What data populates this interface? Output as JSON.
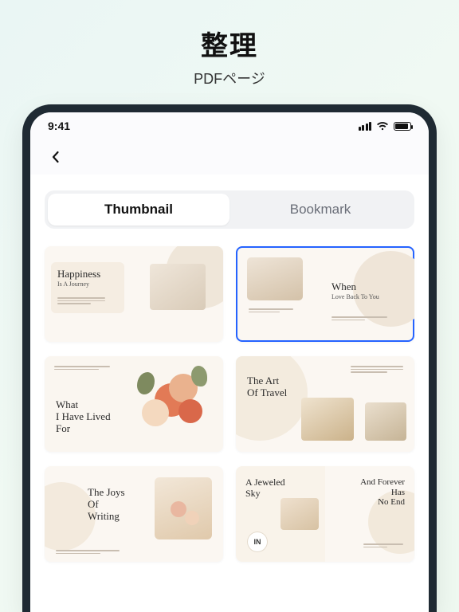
{
  "header": {
    "title": "整理",
    "subtitle": "PDFページ"
  },
  "status": {
    "time": "9:41"
  },
  "segmented": {
    "a": "Thumbnail",
    "b": "Bookmark"
  },
  "thumbs": {
    "t1": {
      "line1": "Happiness",
      "line2": "Is A Journey"
    },
    "t2": {
      "line1": "When",
      "line2": "Love Back To You"
    },
    "t3": {
      "line1": "What",
      "line2": "I Have Lived",
      "line3": "For"
    },
    "t4": {
      "line1": "The Art",
      "line2": "Of Travel"
    },
    "t5": {
      "line1": "The Joys",
      "line2": "Of",
      "line3": "Writing"
    },
    "t6": {
      "a1": "A Jeweled",
      "a2": "Sky",
      "b1": "And Forever",
      "b2": "Has",
      "b3": "No End",
      "badge": "IN"
    }
  }
}
